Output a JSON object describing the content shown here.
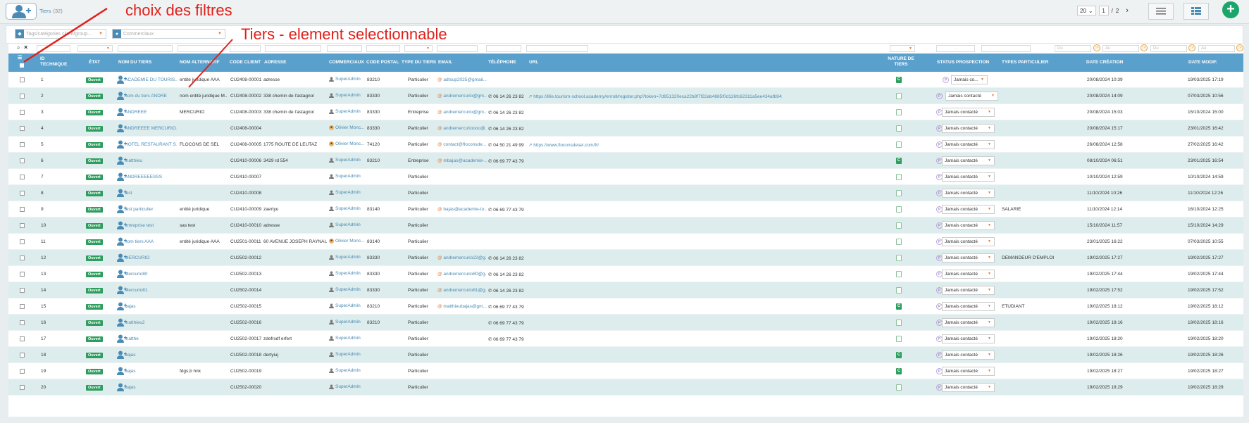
{
  "header": {
    "breadcrumb": "Tiers",
    "count": "(32)",
    "per_page": "20",
    "page_current": "1",
    "page_separator": "/",
    "page_total": "2",
    "next": "›"
  },
  "filters": {
    "tags_placeholder": "Tags/catégories client/group...",
    "commercial_placeholder": "Commerciaux"
  },
  "search_row": {
    "dots": "..",
    "date_from": "Du",
    "date_to": "Au"
  },
  "columns": {
    "id": "ID TECHNIQUE",
    "etat": "ÉTAT",
    "nom": "NOM DU TIERS",
    "nom_alt": "NOM ALTERNATIF",
    "code": "CODE CLIENT",
    "adresse": "ADRESSE",
    "commerciaux": "COMMERCIAUX",
    "cp": "CODE POSTAL",
    "type": "TYPE DU TIERS",
    "email": "EMAIL",
    "tel": "TÉLÉPHONE",
    "url": "URL",
    "nature": "NATURE DE TIERS",
    "status": "STATUS PROSPECTION",
    "types_part": "TYPES PARTICULIER",
    "date_creation": "DATE CRÉATION",
    "date_modif": "DATE MODIF."
  },
  "annotations": {
    "filters": "choix des filtres",
    "tiers": "Tiers - element selectionnable"
  },
  "rows": [
    {
      "id": "1",
      "etat": "Ouvert",
      "nom": "ACADEMIE DU TOURIS...",
      "alt": "entité juridique AAA",
      "code": "CU2408-00001",
      "adresse": "adresse",
      "com": "SuperAdmin",
      "cp": "83210",
      "type": "Particulier",
      "email": "adtsup2025@gmail...",
      "tel": "",
      "url": "",
      "nat": "C",
      "status": "Jamais co...",
      "tp": "",
      "dc": "20/08/2024 10:39",
      "dm": "19/03/2025 17:19"
    },
    {
      "id": "2",
      "etat": "Ouvert",
      "nom": "nom du tiers ANDRE",
      "alt": "nom entité juridique M...",
      "code": "CU2408-00002",
      "adresse": "338 chemin de l'astagnol",
      "com": "SuperAdmin",
      "cp": "83330",
      "type": "Particulier",
      "email": "andremercurio@gm...",
      "tel": "06 14 26 23 82",
      "url": "https://lille.tourism-school.academy/enroll/register.php?token=7d951320eca22b8f7f22ab4885f0d126fc62311a5ee434afb943bf04a1d4",
      "nat": "",
      "status": "Jamais contacté",
      "tp": "",
      "dc": "20/08/2024 14:09",
      "dm": "07/03/2025 10:56"
    },
    {
      "id": "3",
      "etat": "Ouvert",
      "nom": "ANDREEE",
      "alt": "MERCURIO",
      "code": "CU2408-00003",
      "adresse": "338 chemin de l'astagnol",
      "com": "SuperAdmin",
      "cp": "83330",
      "type": "Entreprise",
      "email": "andremercurio@gm...",
      "tel": "06 14 26 23 82",
      "url": "",
      "nat": "",
      "status": "Jamais contacté",
      "tp": "",
      "dc": "20/08/2024 15:03",
      "dm": "15/10/2024 15:00"
    },
    {
      "id": "4",
      "etat": "Ouvert",
      "nom": "ANDREEEE MERCURIO...",
      "alt": "",
      "code": "CU2408-00004",
      "adresse": "",
      "com": "Olivier Monc...",
      "cp": "83330",
      "type": "Particulier",
      "email": "andremercurioooo@...",
      "tel": "06 14 26 23 82",
      "url": "",
      "nat": "",
      "status": "Jamais contacté",
      "tp": "",
      "dc": "20/08/2024 15:17",
      "dm": "23/01/2025 16:42"
    },
    {
      "id": "5",
      "etat": "Ouvert",
      "nom": "HOTEL RESTAURANT S...",
      "alt": "FLOCONS DE SEL",
      "code": "CU2408-00005",
      "adresse": "1775 ROUTE DE LEUTAZ",
      "com": "Olivier Monc...",
      "cp": "74120",
      "type": "Particulier",
      "email": "contact@floconsde...",
      "tel": "04 50 21 49 99",
      "url": "https://www.floconsdesel.com/fr/",
      "nat": "",
      "status": "Jamais contacté",
      "tp": "",
      "dc": "26/08/2024 12:58",
      "dm": "27/02/2025 16:42"
    },
    {
      "id": "6",
      "etat": "Ouvert",
      "nom": "matthieu",
      "alt": "",
      "code": "CU2410-00006",
      "adresse": "3429 rd 554",
      "com": "SuperAdmin",
      "cp": "83210",
      "type": "Entreprise",
      "email": "mbajas@academie-...",
      "tel": "06 69 77 43 79",
      "url": "",
      "nat": "C",
      "status": "Jamais contacté",
      "tp": "",
      "dc": "08/10/2024 06:51",
      "dm": "23/01/2025 16:54"
    },
    {
      "id": "7",
      "etat": "Ouvert",
      "nom": "ANDREEEEESSS",
      "alt": "",
      "code": "CU2410-00007",
      "adresse": "",
      "com": "SuperAdmin",
      "cp": "",
      "type": "Particulier",
      "email": "",
      "tel": "",
      "url": "",
      "nat": "",
      "status": "Jamais contacté",
      "tp": "",
      "dc": "10/10/2024 12:59",
      "dm": "10/10/2024 14:59"
    },
    {
      "id": "8",
      "etat": "Ouvert",
      "nom": "test",
      "alt": "",
      "code": "CU2410-00008",
      "adresse": "",
      "com": "SuperAdmin",
      "cp": "",
      "type": "Particulier",
      "email": "",
      "tel": "",
      "url": "",
      "nat": "",
      "status": "Jamais contacté",
      "tp": "",
      "dc": "11/10/2024 10:26",
      "dm": "11/10/2024 12:26"
    },
    {
      "id": "9",
      "etat": "Ouvert",
      "nom": "test particulier",
      "alt": "entité juridique",
      "code": "CU2410-00009",
      "adresse": "zaertyu",
      "com": "SuperAdmin",
      "cp": "83140",
      "type": "Particulier",
      "email": "bajas@academie-to...",
      "tel": "06 69 77 43 79",
      "url": "",
      "nat": "",
      "status": "Jamais contacté",
      "tp": "SALARIE",
      "dc": "11/10/2024 12:14",
      "dm": "16/10/2024 12:25"
    },
    {
      "id": "10",
      "etat": "Ouvert",
      "nom": "entreprise test",
      "alt": "sas test",
      "code": "CU2410-00010",
      "adresse": "adresse",
      "com": "SuperAdmin",
      "cp": "",
      "type": "Particulier",
      "email": "",
      "tel": "",
      "url": "",
      "nat": "",
      "status": "Jamais contacté",
      "tp": "",
      "dc": "15/10/2024 11:57",
      "dm": "15/10/2024 14:29"
    },
    {
      "id": "11",
      "etat": "Ouvert",
      "nom": "nom tiers AAA",
      "alt": "entité juridique AAA",
      "code": "CU2501-00011",
      "adresse": "60 AVENUE JOSEPH RAYNAUD",
      "com": "Olivier Monc...",
      "cp": "83140",
      "type": "Particulier",
      "email": "",
      "tel": "",
      "url": "",
      "nat": "",
      "status": "Jamais contacté",
      "tp": "",
      "dc": "23/01/2025 16:22",
      "dm": "07/03/2025 10:55"
    },
    {
      "id": "12",
      "etat": "Ouvert",
      "nom": "MERCURIO",
      "alt": "",
      "code": "CU2502-00012",
      "adresse": "",
      "com": "SuperAdmin",
      "cp": "83330",
      "type": "Particulier",
      "email": "andremercurio22@g...",
      "tel": "06 14 26 23 82",
      "url": "",
      "nat": "",
      "status": "Jamais contacté",
      "tp": "DEMANDEUR D'EMPLOI",
      "dc": "19/02/2025 17:27",
      "dm": "19/02/2025 17:27"
    },
    {
      "id": "13",
      "etat": "Ouvert",
      "nom": "Mercurio80",
      "alt": "",
      "code": "CU2502-00013",
      "adresse": "",
      "com": "SuperAdmin",
      "cp": "83330",
      "type": "Particulier",
      "email": "andremercurio80@g...",
      "tel": "06 14 26 23 82",
      "url": "",
      "nat": "",
      "status": "Jamais contacté",
      "tp": "",
      "dc": "19/02/2025 17:44",
      "dm": "19/02/2025 17:44"
    },
    {
      "id": "14",
      "etat": "Ouvert",
      "nom": "Mercurio81",
      "alt": "",
      "code": "CU2502-00014",
      "adresse": "",
      "com": "SuperAdmin",
      "cp": "83330",
      "type": "Particulier",
      "email": "andremercurio81@g...",
      "tel": "06 14 26 23 82",
      "url": "",
      "nat": "",
      "status": "Jamais contacté",
      "tp": "",
      "dc": "19/02/2025 17:52",
      "dm": "19/02/2025 17:52"
    },
    {
      "id": "15",
      "etat": "Ouvert",
      "nom": "bajas",
      "alt": "",
      "code": "CU2502-00015",
      "adresse": "",
      "com": "SuperAdmin",
      "cp": "83210",
      "type": "Particulier",
      "email": "matthieubajas@gm...",
      "tel": "06 69 77 43 79",
      "url": "",
      "nat": "C",
      "status": "Jamais contacté",
      "tp": "ETUDIANT",
      "dc": "19/02/2025 18:12",
      "dm": "19/02/2025 18:12"
    },
    {
      "id": "16",
      "etat": "Ouvert",
      "nom": "matthieu2",
      "alt": "",
      "code": "CU2502-00016",
      "adresse": "",
      "com": "SuperAdmin",
      "cp": "83210",
      "type": "Particulier",
      "email": "",
      "tel": "06 69 77 43 79",
      "url": "",
      "nat": "",
      "status": "Jamais contacté",
      "tp": "",
      "dc": "19/02/2025 18:16",
      "dm": "19/02/2025 18:16"
    },
    {
      "id": "17",
      "etat": "Ouvert",
      "nom": "matthe",
      "alt": "",
      "code": "CU2502-00017",
      "adresse": "zdefrsdf erfert",
      "com": "SuperAdmin",
      "cp": "",
      "type": "Particulier",
      "email": "",
      "tel": "06 69 77 43 79",
      "url": "",
      "nat": "",
      "status": "Jamais contacté",
      "tp": "",
      "dc": "19/02/2025 18:20",
      "dm": "19/02/2025 18:20"
    },
    {
      "id": "18",
      "etat": "Ouvert",
      "nom": "bajas",
      "alt": "",
      "code": "CU2502-00018",
      "adresse": "dertyiuj",
      "com": "SuperAdmin",
      "cp": "",
      "type": "Particulier",
      "email": "",
      "tel": "",
      "url": "",
      "nat": "C",
      "status": "Jamais contacté",
      "tp": "",
      "dc": "19/02/2025 18:26",
      "dm": "19/02/2025 18:26"
    },
    {
      "id": "19",
      "etat": "Ouvert",
      "nom": "bajas",
      "alt": "fdgs,b hnk",
      "code": "CU2502-00019",
      "adresse": "",
      "com": "SuperAdmin",
      "cp": "",
      "type": "Particulier",
      "email": "",
      "tel": "",
      "url": "",
      "nat": "C",
      "status": "Jamais contacté",
      "tp": "",
      "dc": "19/02/2025 18:27",
      "dm": "19/02/2025 18:27"
    },
    {
      "id": "20",
      "etat": "Ouvert",
      "nom": "bajas",
      "alt": "",
      "code": "CU2502-00020",
      "adresse": "",
      "com": "SuperAdmin",
      "cp": "",
      "type": "Particulier",
      "email": "",
      "tel": "",
      "url": "",
      "nat": "",
      "status": "Jamais contacté",
      "tp": "",
      "dc": "19/02/2025 18:29",
      "dm": "19/02/2025 18:29"
    }
  ]
}
